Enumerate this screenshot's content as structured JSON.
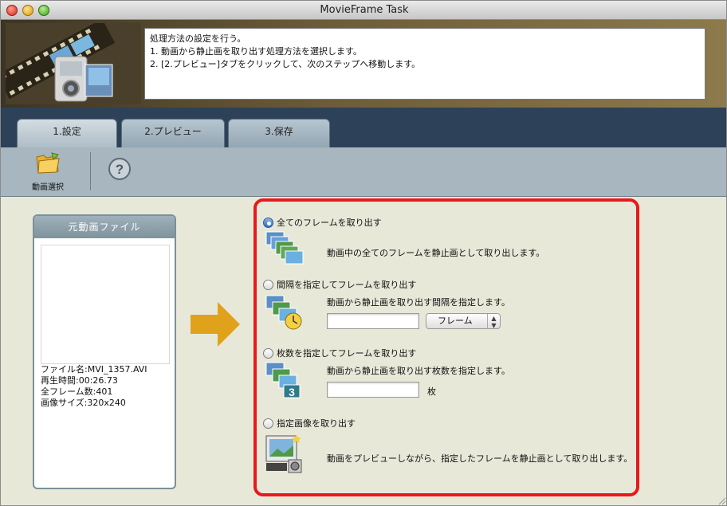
{
  "window": {
    "title": "MovieFrame Task"
  },
  "instructions": {
    "lines": [
      "処理方法の設定を行う。",
      "1. 動画から静止画を取り出す処理方法を選択します。",
      "2. [2.プレビュー]タブをクリックして、次のステップへ移動します。"
    ]
  },
  "tabs": [
    {
      "label": "1.設定",
      "active": true
    },
    {
      "label": "2.プレビュー",
      "active": false
    },
    {
      "label": "3.保存",
      "active": false
    }
  ],
  "toolbar": {
    "select_movie_label": "動画選択",
    "select_movie_icon": "folder-icon",
    "help_icon": "help-icon"
  },
  "source": {
    "header": "元動画ファイル",
    "info": [
      "ファイル名:MVI_1357.AVI",
      "再生時間:00:26.73",
      "全フレーム数:401",
      "画像サイズ:320x240"
    ]
  },
  "options": {
    "all_frames": {
      "label": "全てのフレームを取り出す",
      "selected": true,
      "description": "動画中の全てのフレームを静止画として取り出します。"
    },
    "interval": {
      "label": "間隔を指定してフレームを取り出す",
      "selected": false,
      "description": "動画から静止画を取り出す間隔を指定します。",
      "value": "",
      "unit_selected": "フレーム"
    },
    "count": {
      "label": "枚数を指定してフレームを取り出す",
      "selected": false,
      "description": "動画から静止画を取り出す枚数を指定します。",
      "value": "",
      "unit": "枚"
    },
    "specified": {
      "label": "指定画像を取り出す",
      "selected": false,
      "description": "動画をプレビューしながら、指定したフレームを静止画として取り出します。"
    }
  },
  "colors": {
    "highlight_border": "#e8191b",
    "arrow": "#e0a21a",
    "tab_strip": "#2d4159",
    "toolbar": "#a7b6bf"
  }
}
